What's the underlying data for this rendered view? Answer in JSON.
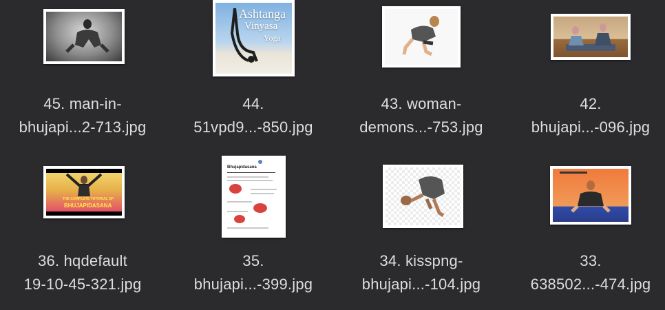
{
  "files": [
    {
      "line1": "45. man-in-",
      "line2": "bhujapi...2-713.jpg",
      "icon": "image-thumbnail"
    },
    {
      "line1": "44.",
      "line2": "51vpd9...-850.jpg",
      "icon": "image-thumbnail"
    },
    {
      "line1": "43. woman-",
      "line2": "demons...-753.jpg",
      "icon": "image-thumbnail"
    },
    {
      "line1": "42.",
      "line2": "bhujapi...-096.jpg",
      "icon": "image-thumbnail"
    },
    {
      "line1": "36. hqdefault",
      "line2": "19-10-45-321.jpg",
      "icon": "image-thumbnail"
    },
    {
      "line1": "35.",
      "line2": "bhujapi...-399.jpg",
      "icon": "image-thumbnail"
    },
    {
      "line1": "34. kisspng-",
      "line2": "bhujapi...-104.jpg",
      "icon": "image-thumbnail"
    },
    {
      "line1": "33.",
      "line2": "638502...-474.jpg",
      "icon": "image-thumbnail"
    }
  ],
  "thumb_text": {
    "ashtanga_title": "Ashtanga",
    "vinyasa_title": "Vinyasa",
    "yoga_title": "Yoga",
    "video_title": "THE COMPLETE TUTORIAL OF",
    "video_subtitle": "OF",
    "video_pose": "BHUJAPIDASANA",
    "doc_title": "Bhujapidasana"
  },
  "colors": {
    "background": "#2b2b2d",
    "label": "#dedede"
  }
}
